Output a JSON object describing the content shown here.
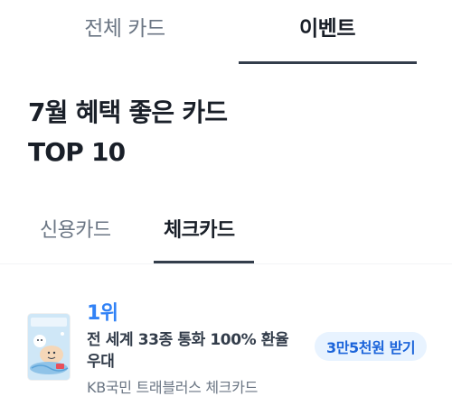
{
  "top_tabs": {
    "all_label": "전체 카드",
    "event_label": "이벤트"
  },
  "headline": {
    "line1": "7월 혜택 좋은 카드",
    "line2": "TOP 10"
  },
  "sub_tabs": {
    "credit_label": "신용카드",
    "check_label": "체크카드"
  },
  "cards": [
    {
      "rank": "1위",
      "benefit": "전 세계 33종 통화 100% 환율 우대",
      "name": "KB국민 트래블러스 체크카드",
      "reward": "3만5천원 받기",
      "thumbnail_icon": "travelers-card-illustration-icon"
    }
  ],
  "colors": {
    "accent_blue": "#3182f6",
    "badge_bg": "#e8f3ff",
    "badge_text": "#1b64da",
    "text_primary": "#191f28",
    "text_secondary": "#6b7684",
    "tab_indicator": "#333d4b"
  }
}
